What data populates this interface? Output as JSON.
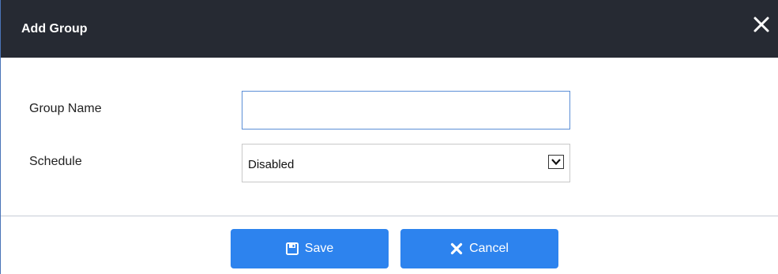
{
  "dialog": {
    "title": "Add Group",
    "close_icon": "close-icon"
  },
  "form": {
    "group_name_label": "Group Name",
    "group_name_value": "",
    "schedule_label": "Schedule",
    "schedule_value": "Disabled",
    "schedule_arrow_icon": "chevron-down-icon"
  },
  "footer": {
    "save_label": "Save",
    "save_icon": "floppy-disk-icon",
    "cancel_label": "Cancel",
    "cancel_icon": "x-icon"
  },
  "colors": {
    "header_bg": "#262a33",
    "button_bg": "#2d83ee",
    "input_focus_border": "#5b8ed6"
  }
}
